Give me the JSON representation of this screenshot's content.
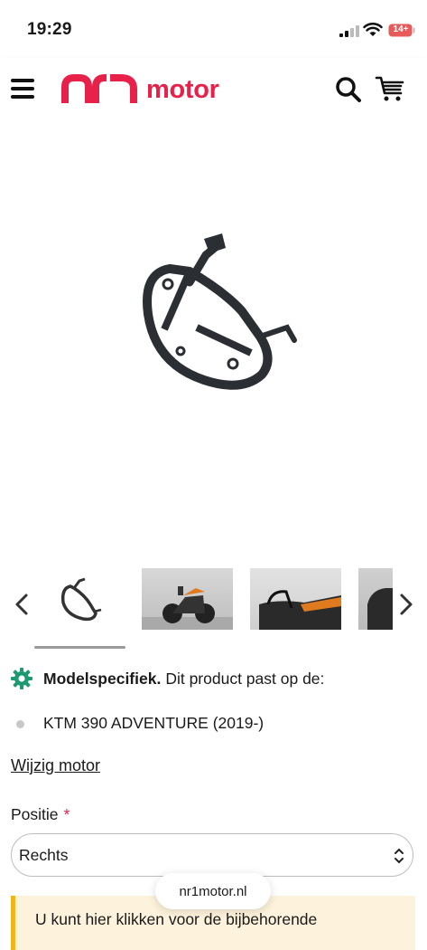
{
  "status_bar": {
    "time": "19:29",
    "battery": "14+"
  },
  "header": {
    "logo_text": "motor"
  },
  "model_info": {
    "label_bold": "Modelspecifiek.",
    "label_rest": "Dit product past op de:",
    "bike": "KTM 390 ADVENTURE (2019-)"
  },
  "change_motor": "Wijzig motor",
  "position": {
    "label": "Positie",
    "required_mark": "*",
    "value": "Rechts"
  },
  "notice": {
    "text": "U kunt hier klikken voor de bijbehorende"
  },
  "browser": {
    "url": "nr1motor.nl"
  },
  "colors": {
    "brand": "#e8214b",
    "accent_green": "#1e9a73",
    "notice_bar": "#f1b51c"
  }
}
